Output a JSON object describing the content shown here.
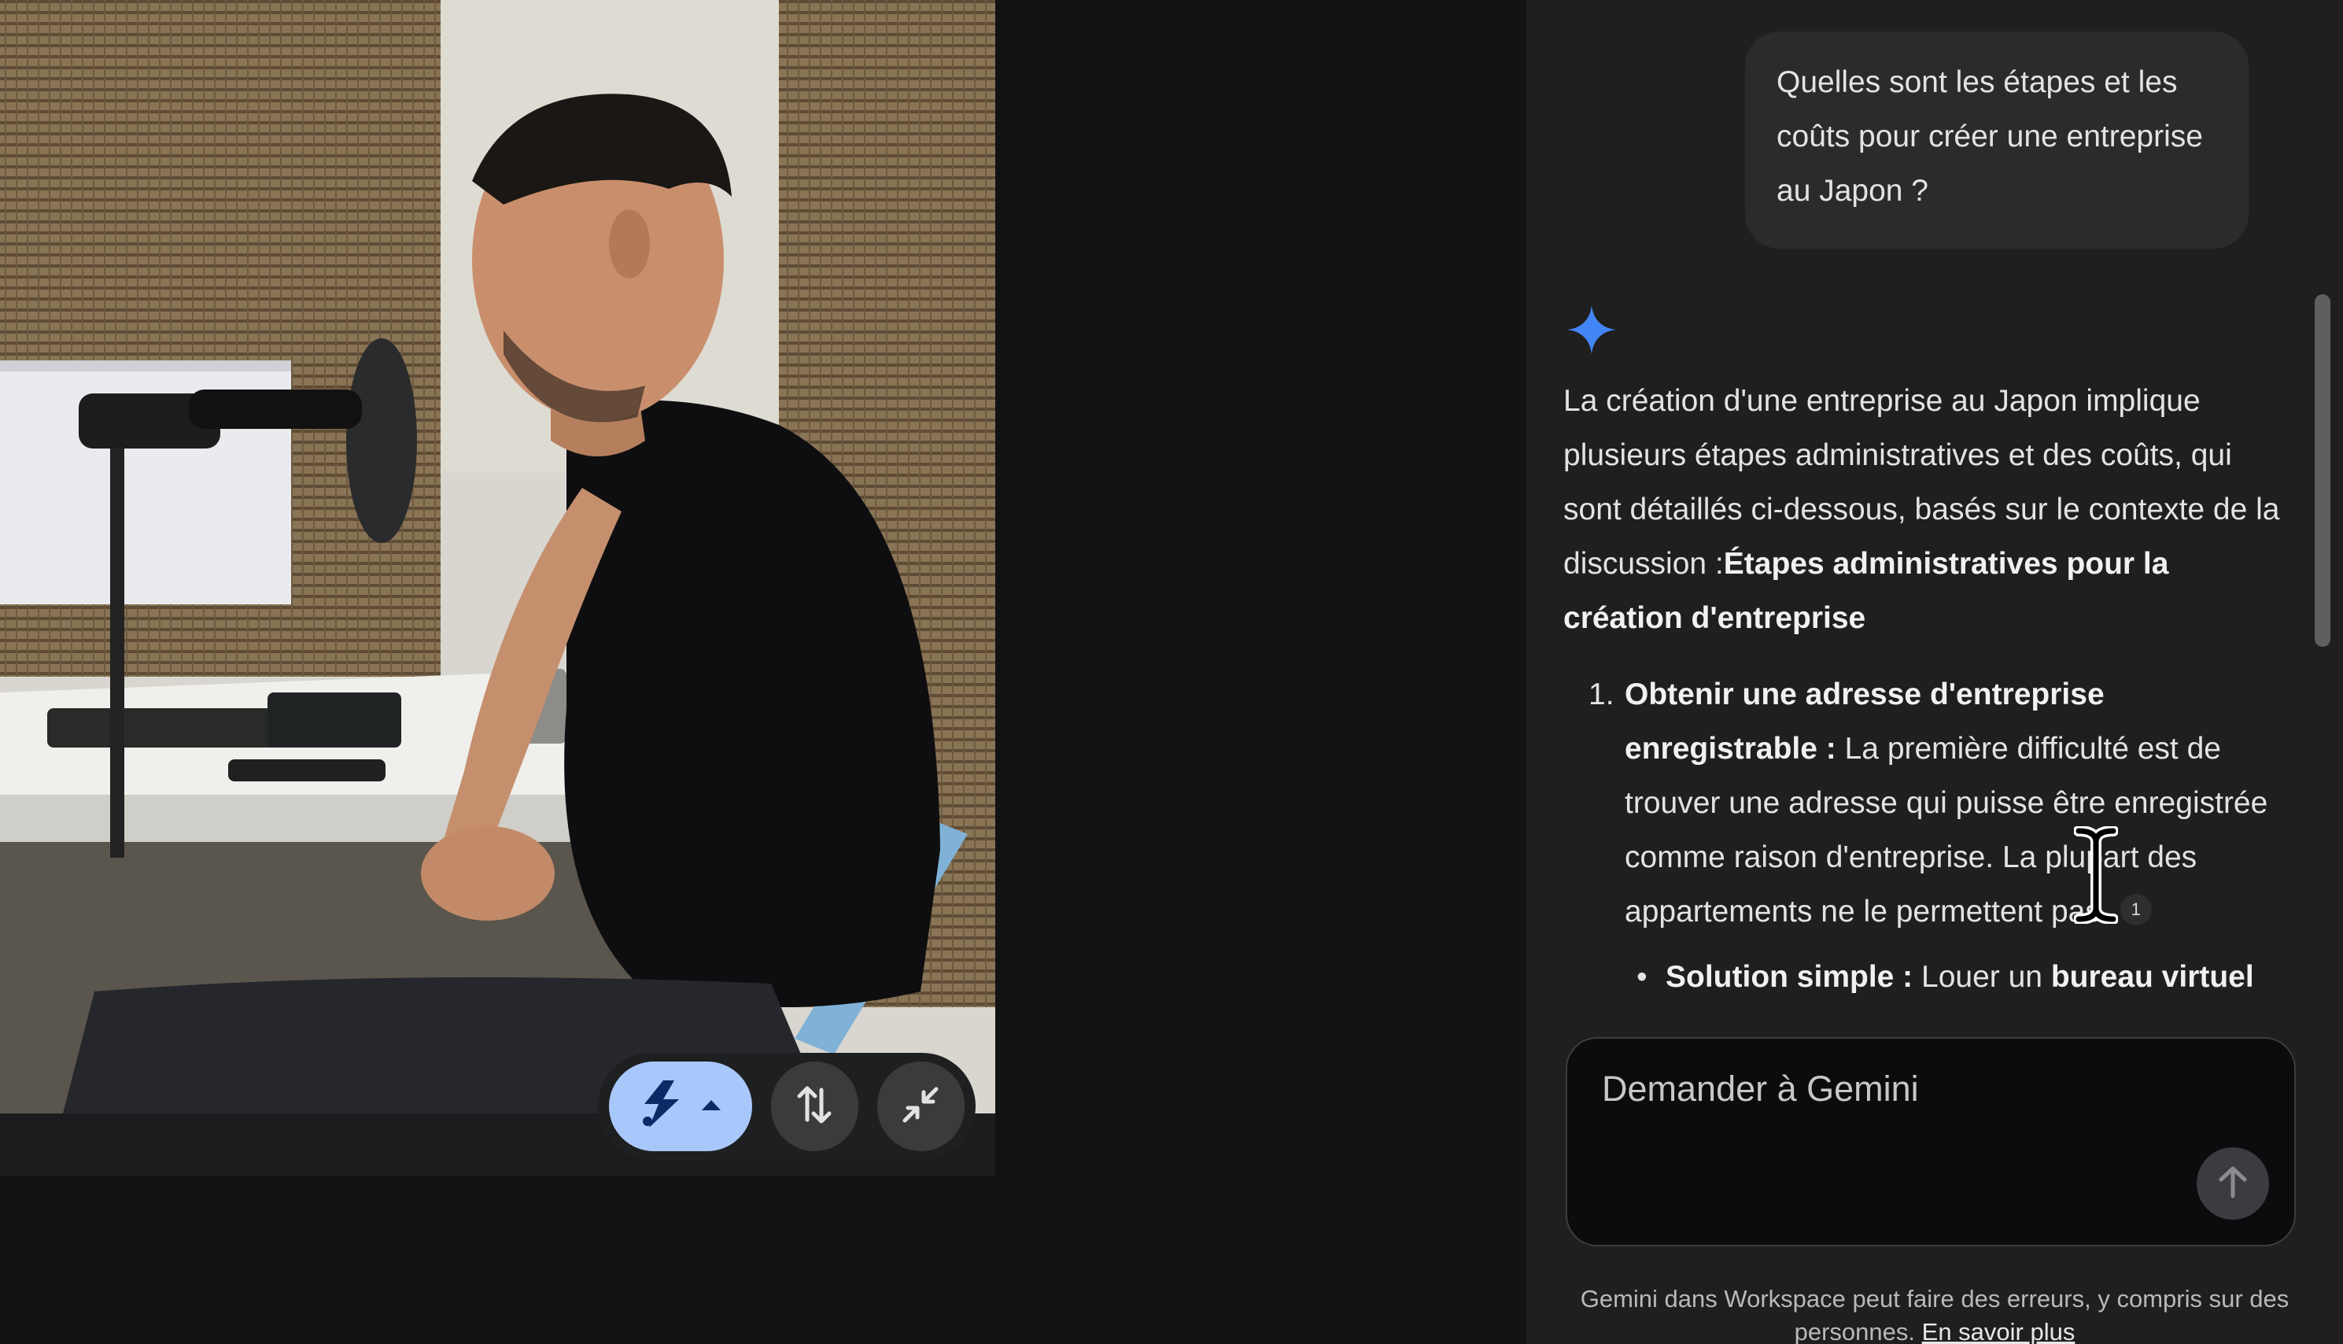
{
  "meet": {
    "controls": {
      "effects_icon": "visual-effects-icon",
      "effects_menu_icon": "caret-up-icon",
      "swap_icon": "swap-vertical-icon",
      "minimize_icon": "minimize-arrows-icon",
      "effects_color": "#a8c7fa"
    }
  },
  "gemini": {
    "user_prompt": "Quelles sont les étapes et les coûts pour créer une entreprise au Japon ?",
    "response": {
      "intro": "La création d'une entreprise au Japon implique plusieurs étapes administratives et des coûts, qui sont détaillés ci-dessous, basés sur le contexte de la discussion :",
      "heading": "Étapes administratives pour la création d'entreprise",
      "items": [
        {
          "number": "1.",
          "title": "Obtenir une adresse d'entreprise enregistrable :",
          "text": " La première difficulté est de trouver une adresse qui puisse être enregistrée comme raison d'entreprise. La plupart des appartements ne le permettent pas.",
          "citation": "1"
        }
      ],
      "sub_item": {
        "bullet": "•",
        "label": "Solution simple :",
        "text": " Louer un ",
        "bold": "bureau virtuel"
      }
    },
    "composer": {
      "placeholder": "Demander à Gemini",
      "send_icon": "arrow-up-icon"
    },
    "disclaimer": {
      "text": "Gemini dans Workspace peut faire des erreurs, y compris sur des personnes.",
      "link": "En savoir plus"
    },
    "accent_color": "#4285f4"
  }
}
